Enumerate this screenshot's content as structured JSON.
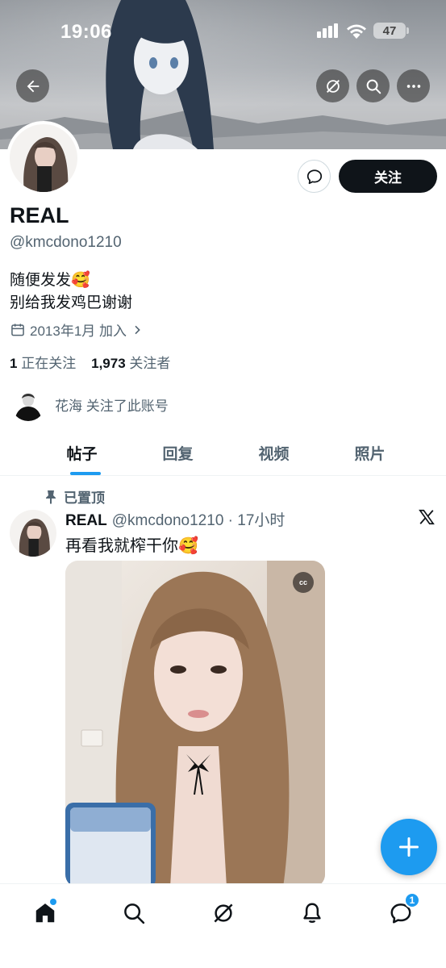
{
  "status_bar": {
    "time": "19:06",
    "battery": "47"
  },
  "profile": {
    "display_name": "REAL",
    "handle": "@kmcdono1210",
    "bio_line1": "随便发发🥰",
    "bio_line2": "别给我发鸡巴谢谢",
    "joined": "2013年1月 加入",
    "following_count": "1",
    "following_label": "正在关注",
    "followers_count": "1,973",
    "followers_label": "关注者",
    "followed_by": "花海 关注了此账号",
    "follow_label": "关注"
  },
  "tabs": [
    {
      "label": "帖子",
      "active": true
    },
    {
      "label": "回复",
      "active": false
    },
    {
      "label": "视频",
      "active": false
    },
    {
      "label": "照片",
      "active": false
    }
  ],
  "post": {
    "pinned_label": "已置顶",
    "author": "REAL",
    "handle_time": "@kmcdono1210 · 17小时",
    "text": "再看我就榨干你🥰",
    "cc_badge": "cc"
  },
  "nav": {
    "messages_badge": "1"
  },
  "colors": {
    "accent": "#1d9bf0",
    "text": "#0f1419",
    "muted": "#536471"
  }
}
